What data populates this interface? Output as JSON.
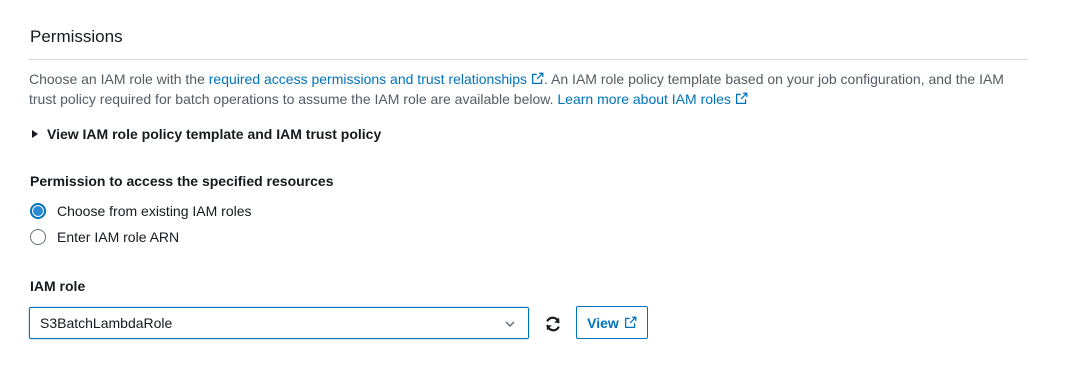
{
  "section": {
    "title": "Permissions",
    "description": {
      "prefix": "Choose an IAM role with the ",
      "link1": "required access permissions and trust relationships",
      "middle": ". An IAM role policy template based on your job configuration, and the IAM trust policy required for batch operations to assume the IAM role are available below. ",
      "link2": "Learn more about IAM roles"
    },
    "expander_label": "View IAM role policy template and IAM trust policy"
  },
  "permission": {
    "label": "Permission to access the specified resources",
    "options": [
      {
        "label": "Choose from existing IAM roles",
        "selected": true
      },
      {
        "label": "Enter IAM role ARN",
        "selected": false
      }
    ]
  },
  "iam_role": {
    "label": "IAM role",
    "selected_value": "S3BatchLambdaRole",
    "view_button": "View"
  },
  "colors": {
    "link": "#0073bb",
    "text": "#16191f",
    "muted_text": "#545b64",
    "divider": "#d5dbdb"
  },
  "icons": [
    "external-link-icon",
    "caret-right-icon",
    "chevron-down-icon",
    "refresh-icon"
  ]
}
